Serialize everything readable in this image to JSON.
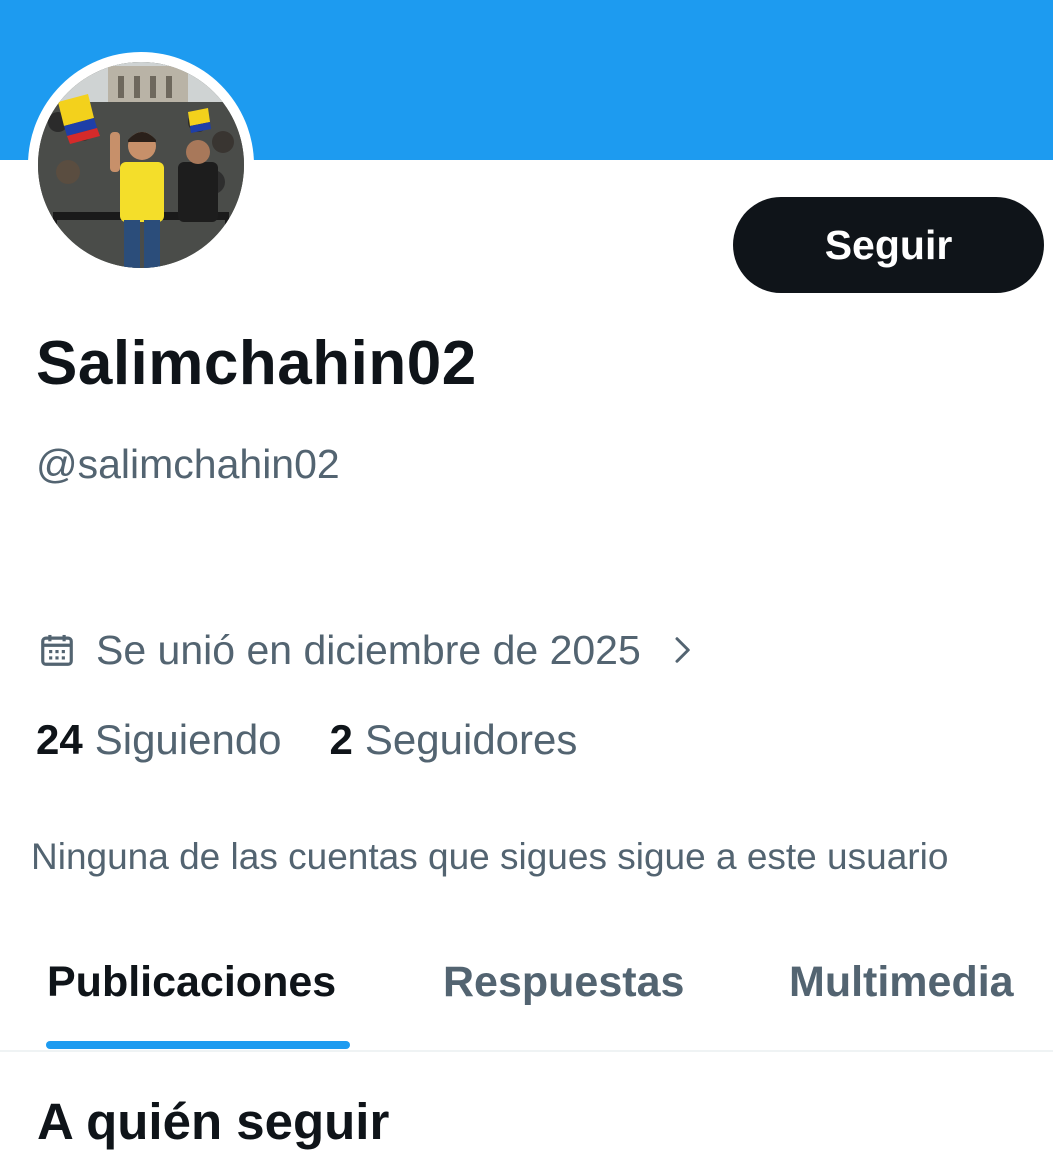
{
  "profile": {
    "follow_label": "Seguir",
    "display_name": "Salimchahin02",
    "handle": "@salimchahin02",
    "joined": "Se unió en diciembre de 2025",
    "following_count": "24",
    "following_label": "Siguiendo",
    "followers_count": "2",
    "followers_label": "Seguidores",
    "mutuals_note": "Ninguna de las cuentas que sigues sigue a este usuario"
  },
  "tabs": [
    {
      "label": "Publicaciones",
      "active": true
    },
    {
      "label": "Respuestas",
      "active": false
    },
    {
      "label": "Multimedia",
      "active": false
    }
  ],
  "section": {
    "title": "A quién seguir"
  },
  "colors": {
    "banner": "#1d9bf0",
    "button_bg": "#0f1419",
    "muted_text": "#536471",
    "accent": "#1d9bf0"
  },
  "icons": {
    "joined": "calendar-icon",
    "joined_more": "chevron-right-icon"
  }
}
